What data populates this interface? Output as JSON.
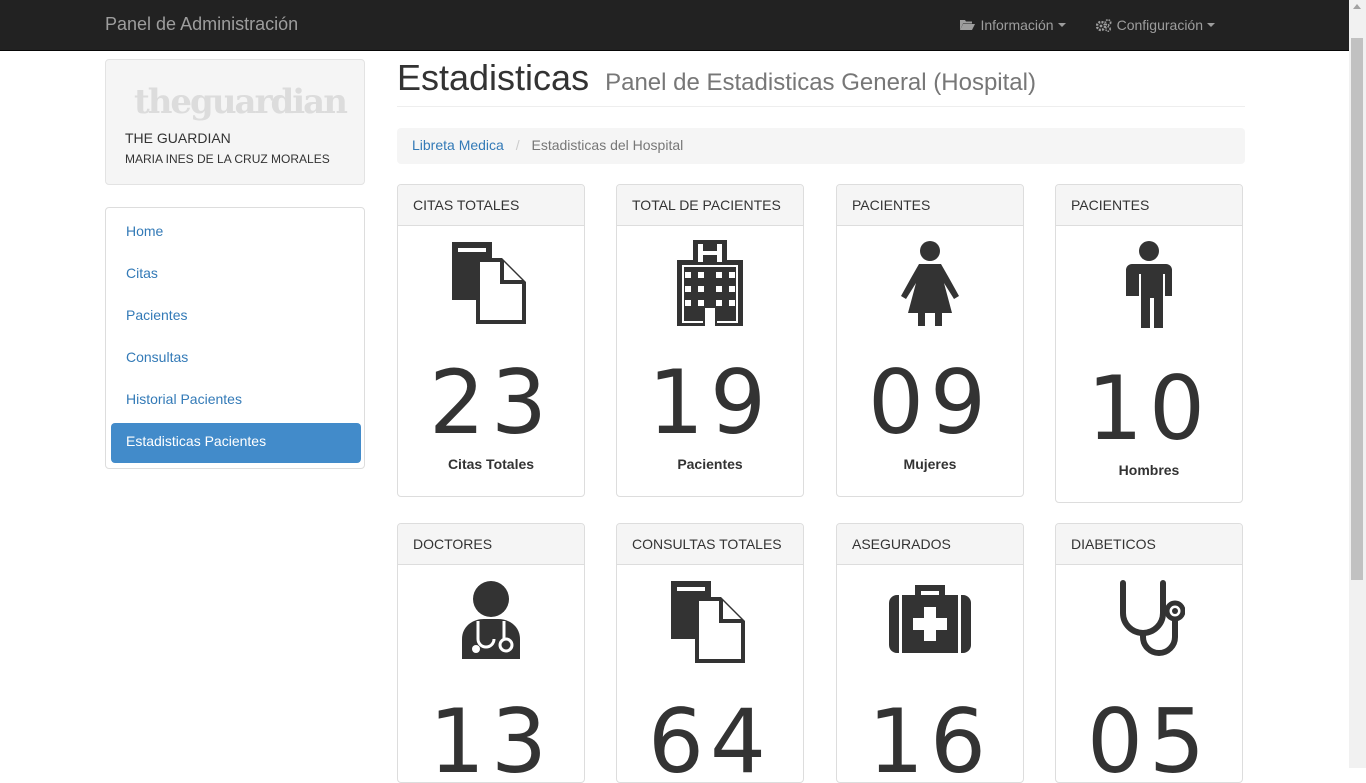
{
  "navbar": {
    "brand": "Panel de Administración",
    "info_label": "Información",
    "config_label": "Configuración"
  },
  "profile": {
    "logo_text": "theguardian",
    "name": "THE GUARDIAN",
    "user": "MARIA INES DE LA CRUZ MORALES"
  },
  "sidebar": {
    "items": [
      {
        "label": "Home"
      },
      {
        "label": "Citas"
      },
      {
        "label": "Pacientes"
      },
      {
        "label": "Consultas"
      },
      {
        "label": "Historial Pacientes"
      },
      {
        "label": "Estadisticas Pacientes",
        "active": true
      }
    ]
  },
  "header": {
    "title": "Estadisticas",
    "subtitle": "Panel de Estadisticas General (Hospital)"
  },
  "breadcrumb": {
    "link": "Libreta Medica",
    "separator": "/",
    "active": "Estadisticas del Hospital"
  },
  "cards": [
    {
      "heading": "CITAS TOTALES",
      "value": "23",
      "caption": "Citas Totales",
      "icon": "files-icon"
    },
    {
      "heading": "TOTAL DE PACIENTES",
      "value": "19",
      "caption": "Pacientes",
      "icon": "hospital-icon"
    },
    {
      "heading": "PACIENTES",
      "value": "09",
      "caption": "Mujeres",
      "icon": "female-icon"
    },
    {
      "heading": "PACIENTES",
      "value": "10",
      "caption": "Hombres",
      "icon": "male-icon"
    },
    {
      "heading": "DOCTORES",
      "value": "13",
      "caption": "",
      "icon": "doctor-icon"
    },
    {
      "heading": "CONSULTAS TOTALES",
      "value": "64",
      "caption": "",
      "icon": "files-icon"
    },
    {
      "heading": "ASEGURADOS",
      "value": "16",
      "caption": "",
      "icon": "medkit-icon"
    },
    {
      "heading": "DIABETICOS",
      "value": "05",
      "caption": "",
      "icon": "stethoscope-icon"
    }
  ],
  "colors": {
    "navbar_bg": "#222222",
    "accent": "#428bca",
    "link": "#337ab7"
  }
}
